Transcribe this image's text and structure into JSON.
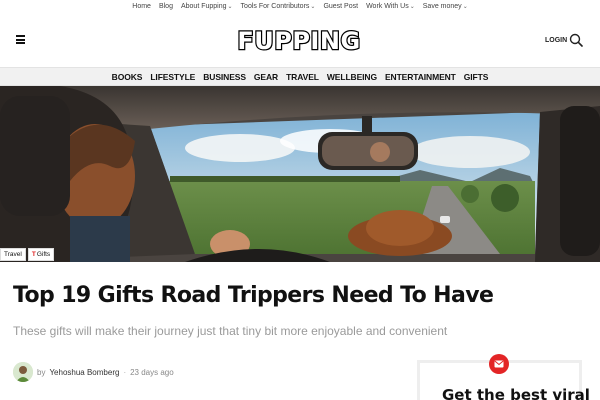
{
  "top_nav": {
    "items": [
      {
        "label": "Home",
        "has_dropdown": false
      },
      {
        "label": "Blog",
        "has_dropdown": false
      },
      {
        "label": "About Fupping",
        "has_dropdown": true
      },
      {
        "label": "Tools For Contributors",
        "has_dropdown": true
      },
      {
        "label": "Guest Post",
        "has_dropdown": false
      },
      {
        "label": "Work With Us",
        "has_dropdown": true
      },
      {
        "label": "Save money",
        "has_dropdown": true
      }
    ],
    "chevron": "⌄"
  },
  "header": {
    "logo_text": "FUPPING",
    "login_label": "LOGIN",
    "menu_icon": "hamburger-icon",
    "search_icon": "search-icon"
  },
  "categories": [
    "BOOKS",
    "LIFESTYLE",
    "BUSINESS",
    "GEAR",
    "TRAVEL",
    "WELLBEING",
    "ENTERTAINMENT",
    "GIFTS"
  ],
  "article": {
    "tags": [
      {
        "label": "Travel"
      },
      {
        "label": "Gifts"
      }
    ],
    "tag_mark": "T",
    "title": "Top 19 Gifts Road Trippers Need To Have",
    "subtitle": "These gifts will make their journey just that tiny bit more enjoyable and convenient",
    "author_prefix": "by",
    "author": "Yehoshua Bomberg",
    "separator": "·",
    "time": "23 days ago"
  },
  "newsletter": {
    "title": "Get the best viral",
    "icon": "mail-icon"
  },
  "colors": {
    "accent": "#e32526",
    "category_bar": "#f1f1f1",
    "subtitle_text": "#9a9a9a"
  }
}
